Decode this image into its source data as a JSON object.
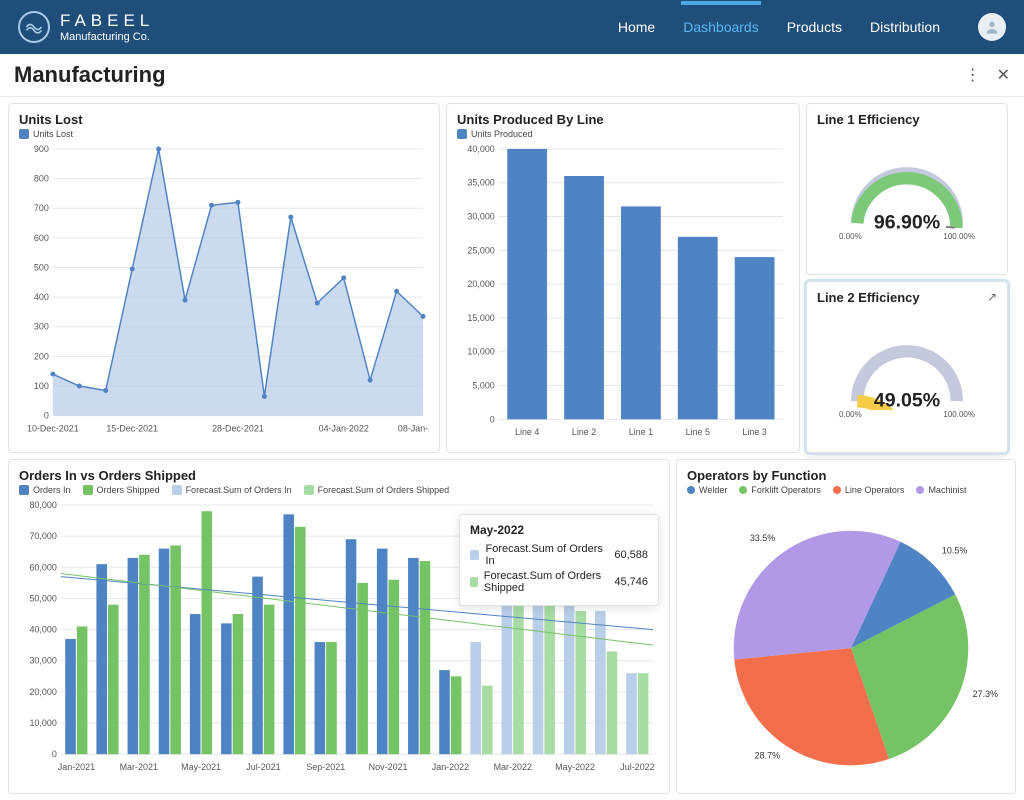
{
  "brand": {
    "name": "FABEEL",
    "sub": "Manufacturing Co."
  },
  "nav": {
    "home": "Home",
    "dashboards": "Dashboards",
    "products": "Products",
    "distribution": "Distribution"
  },
  "page_title": "Manufacturing",
  "colors": {
    "blue": "#4f84c4",
    "lightblue": "#b9cee8",
    "green": "#74c365",
    "lightgreen": "#a8dca5",
    "orange": "#f36f4b",
    "purple": "#b299e8",
    "yellow": "#f6cd46",
    "gauge_green": "#7cc97a",
    "gauge_gray": "#c4c9de"
  },
  "chart_data": [
    {
      "id": "units_lost",
      "type": "area",
      "title": "Units Lost",
      "legend": [
        "Units Lost"
      ],
      "x": [
        "10-Dec-2021",
        "",
        "",
        "15-Dec-2021",
        "",
        "",
        "",
        "28-Dec-2021",
        "",
        "",
        "",
        "04-Jan-2022",
        "",
        "",
        "08-Jan-2022",
        "",
        ""
      ],
      "xticks": [
        "10-Dec-2021",
        "15-Dec-2021",
        "28-Dec-2021",
        "04-Jan-2022",
        "08-Jan-2022"
      ],
      "yticks": [
        0,
        100,
        200,
        300,
        400,
        500,
        600,
        700,
        800,
        900
      ],
      "values": [
        140,
        100,
        85,
        495,
        900,
        390,
        710,
        720,
        65,
        670,
        380,
        465,
        120,
        420,
        335
      ]
    },
    {
      "id": "units_by_line",
      "type": "bar",
      "title": "Units Produced By Line",
      "legend": [
        "Units Produced"
      ],
      "categories": [
        "Line 4",
        "Line 2",
        "Line 1",
        "Line 5",
        "Line 3"
      ],
      "yticks": [
        0,
        5000,
        10000,
        15000,
        20000,
        25000,
        30000,
        35000,
        40000
      ],
      "values": [
        40000,
        36000,
        31500,
        27000,
        24000
      ]
    },
    {
      "id": "line1_eff",
      "type": "gauge",
      "title": "Line 1 Efficiency",
      "value": 96.9,
      "display": "96.90%",
      "min": "0.00%",
      "max": "100.00%",
      "color": "gauge_green"
    },
    {
      "id": "line2_eff",
      "type": "gauge",
      "title": "Line 2 Efficiency",
      "value": 49.05,
      "display": "49.05%",
      "min": "0.00%",
      "max": "100.00%",
      "color": "yellow"
    },
    {
      "id": "orders",
      "type": "bar",
      "title": "Orders In vs Orders Shipped",
      "legend": [
        "Orders In",
        "Orders Shipped",
        "Forecast.Sum of Orders In",
        "Forecast.Sum of Orders Shipped"
      ],
      "categories": [
        "Jan-2021",
        "",
        "Mar-2021",
        "",
        "May-2021",
        "",
        "Jul-2021",
        "",
        "Sep-2021",
        "",
        "Nov-2021",
        "",
        "Jan-2022",
        "",
        "Mar-2022",
        "",
        "May-2022",
        "",
        "Jul-2022"
      ],
      "yticks": [
        0,
        10000,
        20000,
        30000,
        40000,
        50000,
        60000,
        70000,
        80000
      ],
      "series": [
        {
          "name": "Orders In",
          "color": "blue",
          "values": [
            37000,
            61000,
            63000,
            66000,
            45000,
            42000,
            57000,
            77000,
            36000,
            69000,
            66000,
            63000,
            27000,
            null,
            null,
            null,
            null,
            null,
            null
          ]
        },
        {
          "name": "Orders Shipped",
          "color": "green",
          "values": [
            41000,
            48000,
            64000,
            67000,
            78000,
            45000,
            48000,
            73000,
            36000,
            55000,
            56000,
            62000,
            25000,
            null,
            null,
            null,
            null,
            null,
            null
          ]
        },
        {
          "name": "Forecast.Sum of Orders In",
          "color": "lightblue",
          "values": [
            null,
            null,
            null,
            null,
            null,
            null,
            null,
            null,
            null,
            null,
            null,
            null,
            null,
            36000,
            49000,
            57000,
            61000,
            46000,
            26000
          ]
        },
        {
          "name": "Forecast.Sum of Orders Shipped",
          "color": "lightgreen",
          "values": [
            null,
            null,
            null,
            null,
            null,
            null,
            null,
            null,
            null,
            null,
            null,
            null,
            null,
            22000,
            49000,
            52000,
            46000,
            33000,
            26000
          ]
        }
      ],
      "trend_lines": [
        {
          "color": "blue",
          "y0": 57000,
          "y1": 40000
        },
        {
          "color": "green",
          "y0": 58000,
          "y1": 35000
        }
      ],
      "tooltip": {
        "label": "May-2022",
        "rows": [
          {
            "key": "Forecast.Sum of Orders In",
            "val": "60,588",
            "color": "lightblue"
          },
          {
            "key": "Forecast.Sum of Orders Shipped",
            "val": "45,746",
            "color": "lightgreen"
          }
        ]
      }
    },
    {
      "id": "operators",
      "type": "pie",
      "title": "Operators by Function",
      "legend": [
        "Welder",
        "Forklift Operators",
        "Line Operators",
        "Machinist"
      ],
      "slices": [
        {
          "label": "Welder",
          "pct": 10.5,
          "color": "blue"
        },
        {
          "label": "Forklift Operators",
          "pct": 27.3,
          "color": "green"
        },
        {
          "label": "Line Operators",
          "pct": 28.7,
          "color": "orange"
        },
        {
          "label": "Machinist",
          "pct": 33.5,
          "color": "purple"
        }
      ]
    }
  ]
}
